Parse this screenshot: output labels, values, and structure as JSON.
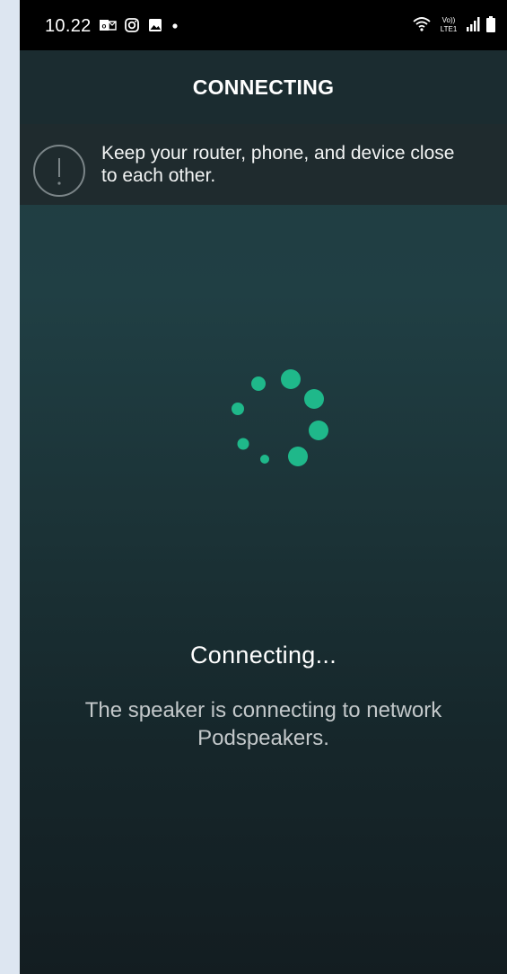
{
  "status_bar": {
    "time": "10.22",
    "left_icons": [
      "outlook-icon",
      "instagram-icon",
      "gallery-icon",
      "dot-icon"
    ],
    "right_icons": [
      "wifi-calling-icon",
      "volte-lte-icon",
      "signal-icon",
      "battery-icon"
    ],
    "volte_text": "Vo))",
    "lte_text": "LTE1"
  },
  "app_bar": {
    "title": "CONNECTING"
  },
  "notice": {
    "icon": "exclamation-circle-icon",
    "text_line1": "Keep your router, phone, and device close",
    "text_line2": "to each other."
  },
  "spinner": {
    "icon": "loading-spinner-icon",
    "color": "#1fb88a"
  },
  "content": {
    "heading": "Connecting...",
    "description_line1": "The speaker is connecting to network",
    "description_line2": "Podspeakers."
  },
  "colors": {
    "accent": "#1fb88a",
    "app_bar": "#1b2c30",
    "notice_bg": "#1f2b2e"
  }
}
